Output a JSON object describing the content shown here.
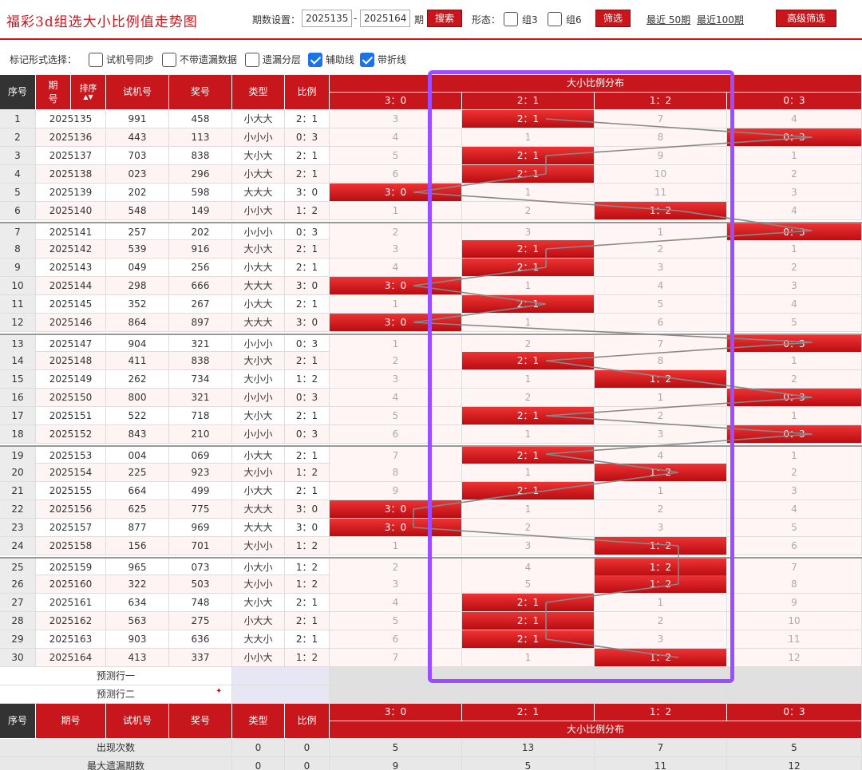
{
  "header": {
    "title": "福彩3d组选大小比例值走势图",
    "period_label": "期数设置：",
    "period_from": "2025135",
    "period_to": "2025164",
    "period_suffix": "期",
    "search_button": "搜索",
    "form_label": "形态：",
    "group3_label": "组3",
    "group6_label": "组6",
    "filter_button": "筛选",
    "recent50": "最近 50期",
    "recent100": "最近100期",
    "advanced_button": "高级筛选"
  },
  "markbar": {
    "label": "标记形式选择：",
    "options": [
      {
        "label": "试机号同步",
        "checked": false
      },
      {
        "label": "不带遗漏数据",
        "checked": false
      },
      {
        "label": "遗漏分层",
        "checked": false
      },
      {
        "label": "辅助线",
        "checked": true
      },
      {
        "label": "带折线",
        "checked": true
      }
    ]
  },
  "table": {
    "headers": {
      "seq": "序号",
      "period": "期号",
      "sort": "排序",
      "trial": "试机号",
      "prize": "奖号",
      "type": "类型",
      "ratio": "比例",
      "dist_title": "大小比例分布"
    },
    "ratio_cols": [
      "3：0",
      "2：1",
      "1：2",
      "0：3"
    ],
    "rows": [
      {
        "seq": "1",
        "period": "2025135",
        "trial": "991",
        "prize": "458",
        "type": "小大大",
        "ratio": "2：1",
        "hit": 1,
        "miss": [
          "3",
          "",
          "7",
          "4"
        ]
      },
      {
        "seq": "2",
        "period": "2025136",
        "trial": "443",
        "prize": "113",
        "type": "小小小",
        "ratio": "0：3",
        "hit": 3,
        "miss": [
          "4",
          "1",
          "8",
          ""
        ]
      },
      {
        "seq": "3",
        "period": "2025137",
        "trial": "703",
        "prize": "838",
        "type": "大小大",
        "ratio": "2：1",
        "hit": 1,
        "miss": [
          "5",
          "",
          "9",
          "1"
        ]
      },
      {
        "seq": "4",
        "period": "2025138",
        "trial": "023",
        "prize": "296",
        "type": "小大大",
        "ratio": "2：1",
        "hit": 1,
        "miss": [
          "6",
          "",
          "10",
          "2"
        ]
      },
      {
        "seq": "5",
        "period": "2025139",
        "trial": "202",
        "prize": "598",
        "type": "大大大",
        "ratio": "3：0",
        "hit": 0,
        "miss": [
          "",
          "1",
          "11",
          "3"
        ]
      },
      {
        "seq": "6",
        "period": "2025140",
        "trial": "548",
        "prize": "149",
        "type": "小小大",
        "ratio": "1：2",
        "hit": 2,
        "miss": [
          "1",
          "2",
          "",
          "4"
        ]
      },
      {
        "seq": "7",
        "period": "2025141",
        "trial": "257",
        "prize": "202",
        "type": "小小小",
        "ratio": "0：3",
        "hit": 3,
        "miss": [
          "2",
          "3",
          "1",
          ""
        ]
      },
      {
        "seq": "8",
        "period": "2025142",
        "trial": "539",
        "prize": "916",
        "type": "大小大",
        "ratio": "2：1",
        "hit": 1,
        "miss": [
          "3",
          "",
          "2",
          "1"
        ]
      },
      {
        "seq": "9",
        "period": "2025143",
        "trial": "049",
        "prize": "256",
        "type": "小大大",
        "ratio": "2：1",
        "hit": 1,
        "miss": [
          "4",
          "",
          "3",
          "2"
        ]
      },
      {
        "seq": "10",
        "period": "2025144",
        "trial": "298",
        "prize": "666",
        "type": "大大大",
        "ratio": "3：0",
        "hit": 0,
        "miss": [
          "",
          "1",
          "4",
          "3"
        ]
      },
      {
        "seq": "11",
        "period": "2025145",
        "trial": "352",
        "prize": "267",
        "type": "小大大",
        "ratio": "2：1",
        "hit": 1,
        "miss": [
          "1",
          "",
          "5",
          "4"
        ]
      },
      {
        "seq": "12",
        "period": "2025146",
        "trial": "864",
        "prize": "897",
        "type": "大大大",
        "ratio": "3：0",
        "hit": 0,
        "miss": [
          "",
          "1",
          "6",
          "5"
        ]
      },
      {
        "seq": "13",
        "period": "2025147",
        "trial": "904",
        "prize": "321",
        "type": "小小小",
        "ratio": "0：3",
        "hit": 3,
        "miss": [
          "1",
          "2",
          "7",
          ""
        ]
      },
      {
        "seq": "14",
        "period": "2025148",
        "trial": "411",
        "prize": "838",
        "type": "大小大",
        "ratio": "2：1",
        "hit": 1,
        "miss": [
          "2",
          "",
          "8",
          "1"
        ]
      },
      {
        "seq": "15",
        "period": "2025149",
        "trial": "262",
        "prize": "734",
        "type": "大小小",
        "ratio": "1：2",
        "hit": 2,
        "miss": [
          "3",
          "1",
          "",
          "2"
        ]
      },
      {
        "seq": "16",
        "period": "2025150",
        "trial": "800",
        "prize": "321",
        "type": "小小小",
        "ratio": "0：3",
        "hit": 3,
        "miss": [
          "4",
          "2",
          "1",
          ""
        ]
      },
      {
        "seq": "17",
        "period": "2025151",
        "trial": "522",
        "prize": "718",
        "type": "大小大",
        "ratio": "2：1",
        "hit": 1,
        "miss": [
          "5",
          "",
          "2",
          "1"
        ]
      },
      {
        "seq": "18",
        "period": "2025152",
        "trial": "843",
        "prize": "210",
        "type": "小小小",
        "ratio": "0：3",
        "hit": 3,
        "miss": [
          "6",
          "1",
          "3",
          ""
        ]
      },
      {
        "seq": "19",
        "period": "2025153",
        "trial": "004",
        "prize": "069",
        "type": "小大大",
        "ratio": "2：1",
        "hit": 1,
        "miss": [
          "7",
          "",
          "4",
          "1"
        ]
      },
      {
        "seq": "20",
        "period": "2025154",
        "trial": "225",
        "prize": "923",
        "type": "大小小",
        "ratio": "1：2",
        "hit": 2,
        "miss": [
          "8",
          "1",
          "",
          "2"
        ]
      },
      {
        "seq": "21",
        "period": "2025155",
        "trial": "664",
        "prize": "499",
        "type": "小大大",
        "ratio": "2：1",
        "hit": 1,
        "miss": [
          "9",
          "",
          "1",
          "3"
        ]
      },
      {
        "seq": "22",
        "period": "2025156",
        "trial": "625",
        "prize": "775",
        "type": "大大大",
        "ratio": "3：0",
        "hit": 0,
        "miss": [
          "",
          "1",
          "2",
          "4"
        ]
      },
      {
        "seq": "23",
        "period": "2025157",
        "trial": "877",
        "prize": "969",
        "type": "大大大",
        "ratio": "3：0",
        "hit": 0,
        "miss": [
          "",
          "2",
          "3",
          "5"
        ]
      },
      {
        "seq": "24",
        "period": "2025158",
        "trial": "156",
        "prize": "701",
        "type": "大小小",
        "ratio": "1：2",
        "hit": 2,
        "miss": [
          "1",
          "3",
          "",
          "6"
        ]
      },
      {
        "seq": "25",
        "period": "2025159",
        "trial": "965",
        "prize": "073",
        "type": "小大小",
        "ratio": "1：2",
        "hit": 2,
        "miss": [
          "2",
          "4",
          "",
          "7"
        ]
      },
      {
        "seq": "26",
        "period": "2025160",
        "trial": "322",
        "prize": "503",
        "type": "大小小",
        "ratio": "1：2",
        "hit": 2,
        "miss": [
          "3",
          "5",
          "",
          "8"
        ]
      },
      {
        "seq": "27",
        "period": "2025161",
        "trial": "634",
        "prize": "748",
        "type": "大小大",
        "ratio": "2：1",
        "hit": 1,
        "miss": [
          "4",
          "",
          "1",
          "9"
        ]
      },
      {
        "seq": "28",
        "period": "2025162",
        "trial": "563",
        "prize": "275",
        "type": "小大大",
        "ratio": "2：1",
        "hit": 1,
        "miss": [
          "5",
          "",
          "2",
          "10"
        ]
      },
      {
        "seq": "29",
        "period": "2025163",
        "trial": "903",
        "prize": "636",
        "type": "大大小",
        "ratio": "2：1",
        "hit": 1,
        "miss": [
          "6",
          "",
          "3",
          "11"
        ]
      },
      {
        "seq": "30",
        "period": "2025164",
        "trial": "413",
        "prize": "337",
        "type": "小小大",
        "ratio": "1：2",
        "hit": 2,
        "miss": [
          "7",
          "1",
          "",
          "12"
        ]
      }
    ],
    "predict": [
      "预测行一",
      "预测行二"
    ],
    "footer_headers": {
      "seq": "序号",
      "period": "期号",
      "trial": "试机号",
      "prize": "奖号",
      "type": "类型",
      "ratio": "比例",
      "dist_title": "大小比例分布"
    },
    "stats": {
      "label": "出现次数",
      "type": "0",
      "ratio": "0",
      "values": [
        "5",
        "13",
        "7",
        "5"
      ]
    },
    "stats_partial": {
      "label": "最大遗漏期数",
      "type": "0",
      "ratio": "0",
      "values": [
        "9",
        "5",
        "11",
        "12"
      ]
    }
  },
  "colors": {
    "brand_red": "#c8161d",
    "highlight_purple": "#9b4dff",
    "check_blue": "#1a73e8"
  }
}
